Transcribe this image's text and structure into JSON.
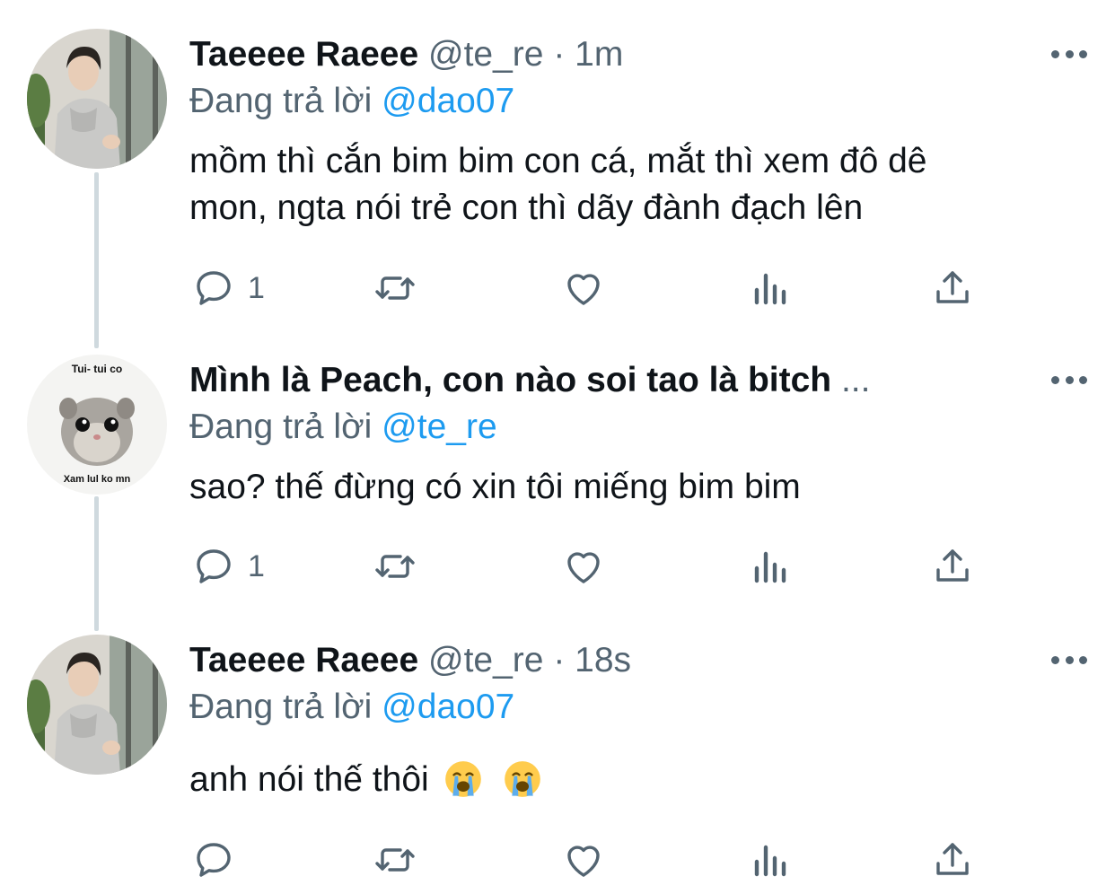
{
  "tweets": [
    {
      "name": "Taeeee Raeee",
      "handle": "@te_re",
      "separator": "·",
      "time": "1m",
      "replying_prefix": "Đang trả lời",
      "replying_to": "@dao07",
      "text_line1": "mồm thì cắn bim bim con cá, mắt thì xem đô dê",
      "text_line2": "mon, ngta nói trẻ con thì dãy đành đạch lên",
      "reply_count": "1",
      "avatar": "person-photo"
    },
    {
      "name": "Mình là Peach, con nào soi tao là bitch",
      "name_ellipsis": "...",
      "replying_prefix": "Đang trả lời",
      "replying_to": "@te_re",
      "text_line1": "sao? thế đừng có xin tôi miếng bim bim",
      "reply_count": "1",
      "avatar_top_text": "Tui- tui co",
      "avatar_bottom_text": "Xam lul ko mn",
      "avatar": "hamster-meme"
    },
    {
      "name": "Taeeee Raeee",
      "handle": "@te_re",
      "separator": "·",
      "time": "18s",
      "replying_prefix": "Đang trả lời",
      "replying_to": "@dao07",
      "text_line1": "anh nói thế thôi",
      "emojis": [
        "loudly-crying-face",
        "loudly-crying-face"
      ],
      "avatar": "person-photo"
    }
  ],
  "icons": [
    "reply-icon",
    "retweet-icon",
    "like-icon",
    "analytics-icon",
    "share-icon",
    "more-icon"
  ],
  "colors": {
    "text": "#0f1419",
    "secondary": "#536471",
    "mention": "#1d9bf0",
    "thread_line": "#cfd9de"
  }
}
